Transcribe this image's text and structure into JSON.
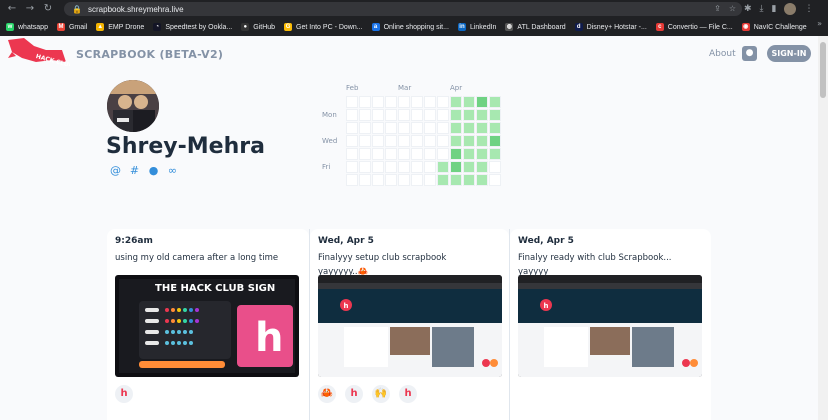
{
  "browser": {
    "url": "scrapbook.shreymehra.live",
    "bookmarks": [
      {
        "label": "whatsapp",
        "color": "#25d366",
        "glyph": "w"
      },
      {
        "label": "Gmail",
        "color": "#ea4335",
        "glyph": "M"
      },
      {
        "label": "EMP Drone",
        "color": "#f4b400",
        "glyph": "▲"
      },
      {
        "label": "Speedtest by Ookla...",
        "color": "#141526",
        "glyph": "◔"
      },
      {
        "label": "GitHub",
        "color": "#333333",
        "glyph": "●"
      },
      {
        "label": "Get Into PC - Down...",
        "color": "#fbbc05",
        "glyph": "G"
      },
      {
        "label": "Online shopping sit...",
        "color": "#1a73e8",
        "glyph": "a"
      },
      {
        "label": "LinkedIn",
        "color": "#0a66c2",
        "glyph": "in"
      },
      {
        "label": "ATL Dashboard",
        "color": "#555555",
        "glyph": "◍"
      },
      {
        "label": "Disney+ Hotstar -...",
        "color": "#0f1b4c",
        "glyph": "d"
      },
      {
        "label": "Convertio — File C...",
        "color": "#e53935",
        "glyph": "c"
      },
      {
        "label": "NavIC Challenge",
        "color": "#e53935",
        "glyph": "◉"
      }
    ]
  },
  "header": {
    "site_title": "SCRAPBOOK (BETA-V2)",
    "flag_text": "HACK CLUB",
    "about_label": "About",
    "signin_label": "SIGN-IN"
  },
  "profile": {
    "username": "Shrey-Mehra",
    "socials": [
      {
        "icon": "at-icon",
        "glyph": "@"
      },
      {
        "icon": "slack-icon",
        "glyph": "#"
      },
      {
        "icon": "github-icon",
        "glyph": "●"
      },
      {
        "icon": "link-icon",
        "glyph": "∞"
      }
    ]
  },
  "heatmap": {
    "months": [
      "Feb",
      "Mar",
      "Apr"
    ],
    "days": [
      "Mon",
      "Wed",
      "Fri"
    ],
    "colors": {
      "empty": "#ffffff",
      "l1": "#a7e8b0",
      "l2": "#6fd283",
      "l3": "#33b054"
    },
    "columns": [
      [
        0,
        0,
        0,
        0,
        0,
        0,
        0
      ],
      [
        0,
        0,
        0,
        0,
        0,
        0,
        0
      ],
      [
        0,
        0,
        0,
        0,
        0,
        0,
        0
      ],
      [
        0,
        0,
        0,
        0,
        0,
        0,
        0
      ],
      [
        0,
        0,
        0,
        0,
        0,
        0,
        0
      ],
      [
        0,
        0,
        0,
        0,
        0,
        0,
        0
      ],
      [
        0,
        0,
        0,
        0,
        0,
        0,
        0
      ],
      [
        0,
        0,
        0,
        0,
        0,
        1,
        1
      ],
      [
        1,
        1,
        1,
        1,
        2,
        2,
        1
      ],
      [
        1,
        1,
        1,
        1,
        1,
        1,
        1
      ],
      [
        2,
        1,
        1,
        1,
        1,
        1,
        1
      ],
      [
        1,
        1,
        1,
        2,
        1,
        0,
        0
      ]
    ]
  },
  "posts": [
    {
      "time": "9:26am",
      "text": "using my old camera after a long time",
      "image": "hack-club-sign",
      "image_text": "THE HACK CLUB SIGN",
      "reactions": [
        "h"
      ]
    },
    {
      "time": "Wed, Apr 5",
      "text": "Finalyyy setup club scrapbook yayyyyy..🦀",
      "image": "scrapbook-screenshot",
      "reactions": [
        "🦀",
        "h",
        "🙌",
        "h"
      ]
    },
    {
      "time": "Wed, Apr 5",
      "text": "Finalyy ready with club Scrapbook... yayyyy",
      "image": "scrapbook-screenshot",
      "reactions": []
    }
  ]
}
